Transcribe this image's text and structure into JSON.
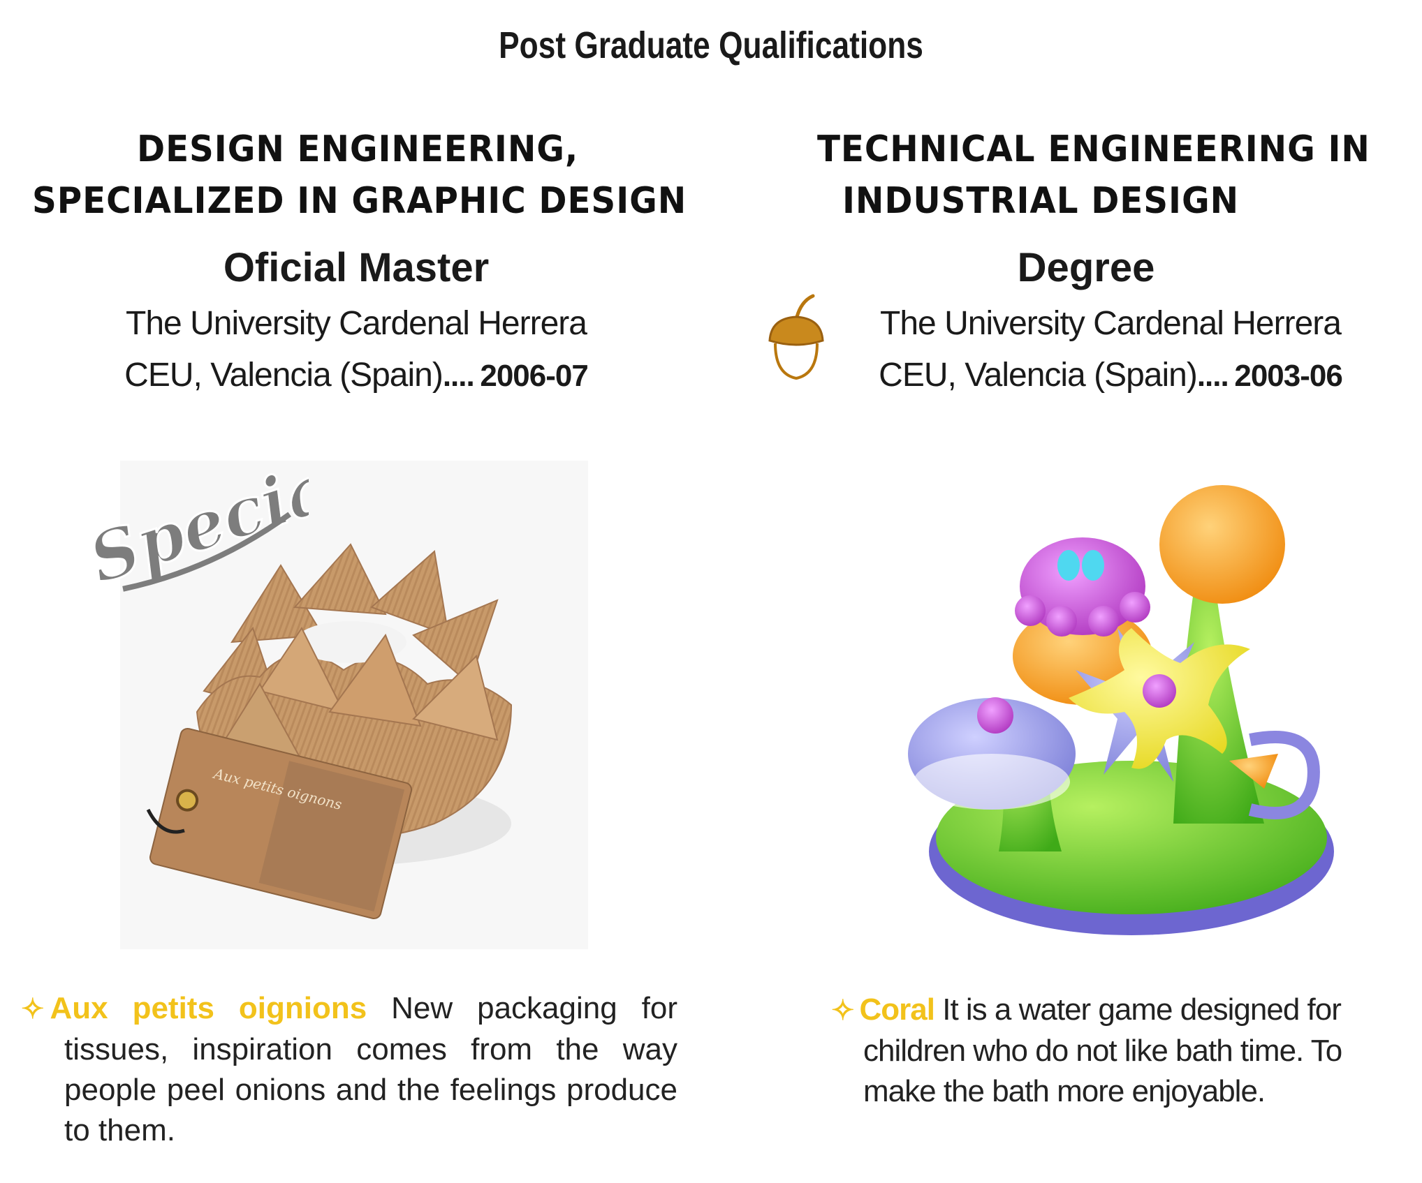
{
  "page_title": "Post Graduate Qualifications",
  "left": {
    "program_line1": "DESIGN ENGINEERING,",
    "program_line2": "SPECIALIZED IN GRAPHIC DESIGN",
    "degree_type": "Oficial Master",
    "university_line1": "The University Cardenal Herrera",
    "university_line2": "CEU, Valencia (Spain)",
    "dots": "....",
    "years": "2006-07",
    "badge": "Special",
    "tag_text": "Aux petits oignons",
    "project_name": "Aux petits oignions",
    "project_desc": "New packaging for tissues, inspiration comes from the way people peel onions and the feelings produce to them."
  },
  "right": {
    "program_line1": "TECHNICAL ENGINEERING IN",
    "program_line2": "INDUSTRIAL DESIGN",
    "degree_type": "Degree",
    "university_line1": "The University Cardenal Herrera",
    "university_line2": "CEU, Valencia (Spain)",
    "dots": "....",
    "years": "2003-06",
    "project_name": "Coral",
    "project_desc": "It is a water game designed for children who do not like bath time. To make the bath more enjoyable."
  },
  "icons": {
    "bullet": "four-point-star-bullet",
    "acorn": "acorn-icon"
  },
  "colors": {
    "accent_yellow": "#f2c21b",
    "acorn_brown": "#b9770e",
    "badge_gray": "#7d7d7d"
  }
}
